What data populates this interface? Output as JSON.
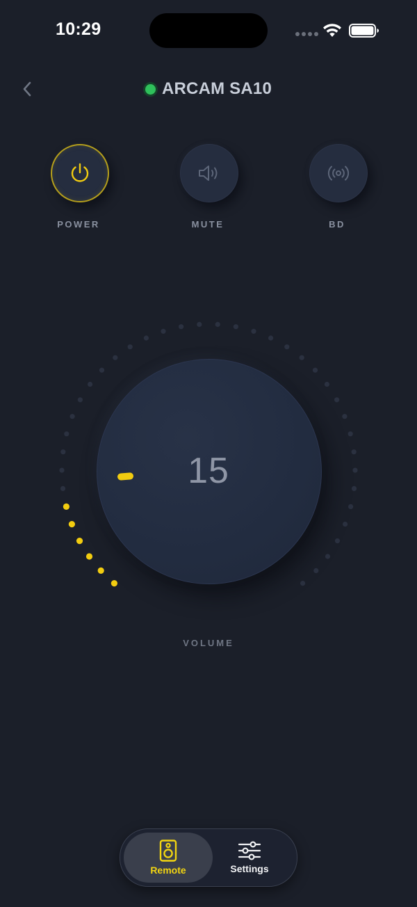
{
  "status_bar": {
    "time": "10:29"
  },
  "header": {
    "device_name": "ARCAM SA10",
    "connection_status_color": "#2fc05b"
  },
  "controls": [
    {
      "id": "power",
      "label": "POWER",
      "icon": "power-icon",
      "active": true
    },
    {
      "id": "mute",
      "label": "MUTE",
      "icon": "speaker-icon",
      "active": false
    },
    {
      "id": "bd",
      "label": "BD",
      "icon": "broadcast-icon",
      "active": false
    }
  ],
  "volume": {
    "label": "VOLUME",
    "value": "15",
    "level_fraction": 0.15
  },
  "tabbar": {
    "tabs": [
      {
        "id": "remote",
        "label": "Remote",
        "icon": "speaker-box-icon",
        "selected": true
      },
      {
        "id": "settings",
        "label": "Settings",
        "icon": "sliders-icon",
        "selected": false
      }
    ]
  },
  "colors": {
    "accent": "#f2cc10",
    "background": "#1b1f29",
    "button": "#252d3f"
  }
}
